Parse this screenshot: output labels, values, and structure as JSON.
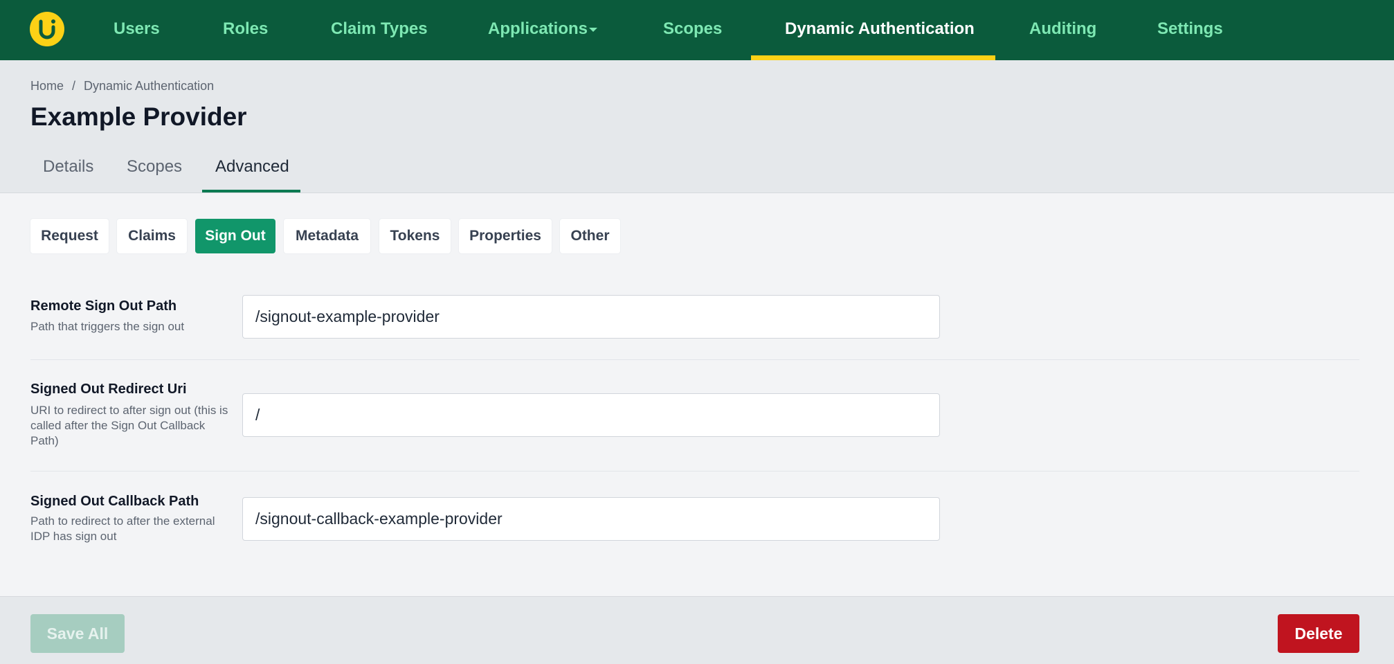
{
  "nav": {
    "logo_letter": "U",
    "items": [
      "Users",
      "Roles",
      "Claim Types",
      "Applications",
      "Scopes",
      "Dynamic Authentication",
      "Auditing",
      "Settings"
    ],
    "active_index": 5
  },
  "breadcrumb": {
    "home": "Home",
    "separator": "/",
    "current": "Dynamic Authentication"
  },
  "page": {
    "title": "Example Provider"
  },
  "tabs": [
    "Details",
    "Scopes",
    "Advanced"
  ],
  "active_tab": "Advanced",
  "subtabs": [
    "Request",
    "Claims",
    "Sign Out",
    "Metadata",
    "Tokens",
    "Properties",
    "Other"
  ],
  "active_subtab": "Sign Out",
  "fields": [
    {
      "label": "Remote Sign Out Path",
      "description": "Path that triggers the sign out",
      "value": "/signout-example-provider"
    },
    {
      "label": "Signed Out Redirect Uri",
      "description": "URI to redirect to after sign out (this is called after the Sign Out Callback Path)",
      "value": "/"
    },
    {
      "label": "Signed Out Callback Path",
      "description": "Path to redirect to after the external IDP has sign out",
      "value": "/signout-callback-example-provider"
    }
  ],
  "footer": {
    "save_label": "Save All",
    "delete_label": "Delete"
  },
  "colors": {
    "nav_bg": "#0b5b3c",
    "nav_text": "#7ee8b3",
    "nav_accent": "#fcd116",
    "primary": "#11966a",
    "danger": "#c0141f"
  }
}
